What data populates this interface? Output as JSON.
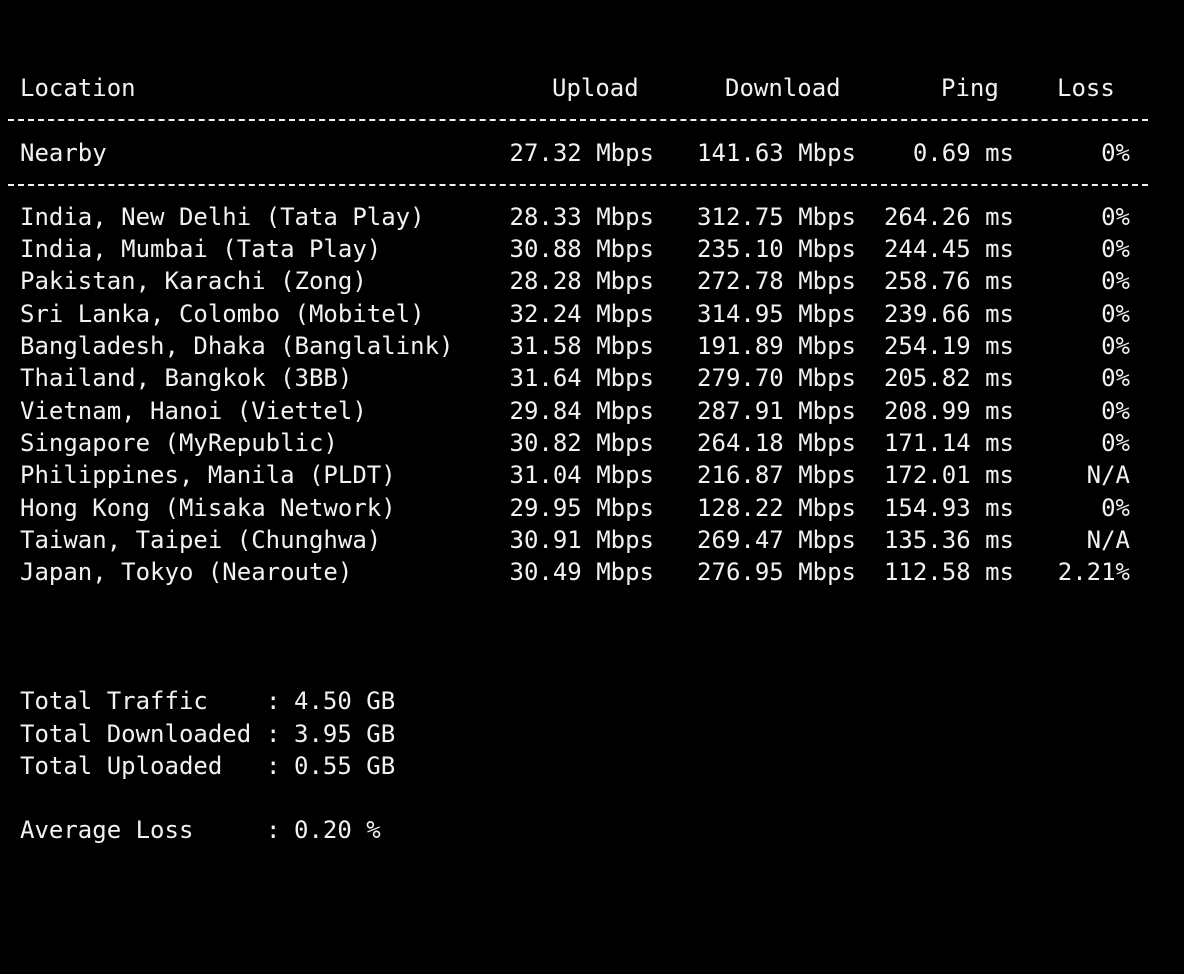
{
  "header": {
    "location": "Location",
    "upload": "Upload",
    "download": "Download",
    "ping": "Ping",
    "loss": "Loss"
  },
  "nearby": {
    "location": "Nearby",
    "upload": "27.32 Mbps",
    "download": "141.63 Mbps",
    "ping": "0.69 ms",
    "loss": "0%"
  },
  "rows": [
    {
      "location": "India, New Delhi (Tata Play)",
      "upload": "28.33 Mbps",
      "download": "312.75 Mbps",
      "ping": "264.26 ms",
      "loss": "0%"
    },
    {
      "location": "India, Mumbai (Tata Play)",
      "upload": "30.88 Mbps",
      "download": "235.10 Mbps",
      "ping": "244.45 ms",
      "loss": "0%"
    },
    {
      "location": "Pakistan, Karachi (Zong)",
      "upload": "28.28 Mbps",
      "download": "272.78 Mbps",
      "ping": "258.76 ms",
      "loss": "0%"
    },
    {
      "location": "Sri Lanka, Colombo (Mobitel)",
      "upload": "32.24 Mbps",
      "download": "314.95 Mbps",
      "ping": "239.66 ms",
      "loss": "0%"
    },
    {
      "location": "Bangladesh, Dhaka (Banglalink)",
      "upload": "31.58 Mbps",
      "download": "191.89 Mbps",
      "ping": "254.19 ms",
      "loss": "0%"
    },
    {
      "location": "Thailand, Bangkok (3BB)",
      "upload": "31.64 Mbps",
      "download": "279.70 Mbps",
      "ping": "205.82 ms",
      "loss": "0%"
    },
    {
      "location": "Vietnam, Hanoi (Viettel)",
      "upload": "29.84 Mbps",
      "download": "287.91 Mbps",
      "ping": "208.99 ms",
      "loss": "0%"
    },
    {
      "location": "Singapore (MyRepublic)",
      "upload": "30.82 Mbps",
      "download": "264.18 Mbps",
      "ping": "171.14 ms",
      "loss": "0%"
    },
    {
      "location": "Philippines, Manila (PLDT)",
      "upload": "31.04 Mbps",
      "download": "216.87 Mbps",
      "ping": "172.01 ms",
      "loss": "N/A"
    },
    {
      "location": "Hong Kong (Misaka Network)",
      "upload": "29.95 Mbps",
      "download": "128.22 Mbps",
      "ping": "154.93 ms",
      "loss": "0%"
    },
    {
      "location": "Taiwan, Taipei (Chunghwa)",
      "upload": "30.91 Mbps",
      "download": "269.47 Mbps",
      "ping": "135.36 ms",
      "loss": "N/A"
    },
    {
      "location": "Japan, Tokyo (Nearoute)",
      "upload": "30.49 Mbps",
      "download": "276.95 Mbps",
      "ping": "112.58 ms",
      "loss": "2.21%"
    }
  ],
  "summary": {
    "total_traffic_label": "Total Traffic",
    "total_traffic_value": "4.50 GB",
    "total_downloaded_label": "Total Downloaded",
    "total_downloaded_value": "3.95 GB",
    "total_uploaded_label": "Total Uploaded",
    "total_uploaded_value": "0.55 GB",
    "average_loss_label": "Average Loss",
    "average_loss_value": "0.20 %",
    "separator": ":"
  }
}
